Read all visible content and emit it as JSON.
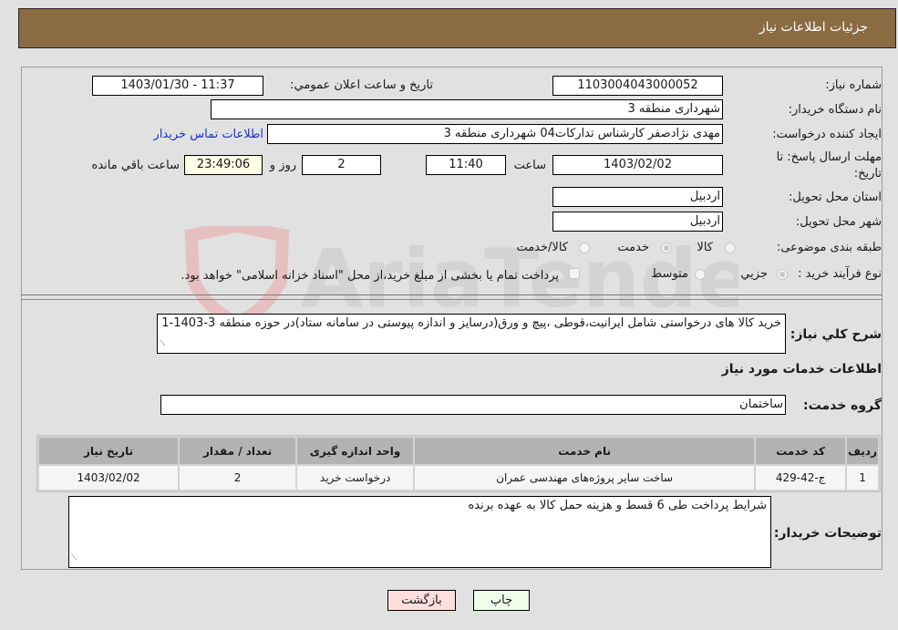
{
  "header": {
    "title": "جزئیات اطلاعات نیاز"
  },
  "form": {
    "need_number": {
      "label": "شماره نیاز:",
      "value": "1103004043000052"
    },
    "announce_datetime": {
      "label": "تاریخ و ساعت اعلان عمومي:",
      "value": "1403/01/30 - 11:37"
    },
    "buyer_org": {
      "label": "نام دستگاه خریدار:",
      "value": "شهرداری منطقه 3"
    },
    "requester": {
      "label": "ایجاد کننده درخواست:",
      "value": "مهدی نژادصفر کارشناس تدارکات04 شهرداری منطقه 3",
      "contact_link": "اطلاعات تماس خریدار"
    },
    "deadline": {
      "label_line1": "مهلت ارسال پاسخ: تا",
      "label_line2": "تاریخ:",
      "date": "1403/02/02",
      "time_label": "ساعت",
      "time": "11:40",
      "days": "2",
      "days_label": "روز و",
      "remaining": "23:49:06",
      "remaining_label": "ساعت باقي مانده"
    },
    "province": {
      "label": "استان محل تحویل:",
      "value": "اردبیل"
    },
    "city": {
      "label": "شهر محل تحویل:",
      "value": "اردبیل"
    },
    "category": {
      "label": "طبقه بندی موضوعی:",
      "options": [
        "کالا",
        "خدمت",
        "کالا/خدمت"
      ],
      "selected": "خدمت"
    },
    "purchase_type": {
      "label": "نوع فرآیند خرید :",
      "options": [
        "جزيي",
        "متوسط"
      ],
      "selected": "جزيي",
      "treasury_text": "پرداخت تمام یا بخشی از مبلغ خرید،از محل \"اسناد خزانه اسلامی\" خواهد بود."
    }
  },
  "description": {
    "label": "شرح کلي نياز:",
    "value": "خرید کالا های درخواستی شامل ایرانیت،قوطی ،پیچ و ورق(درسایز و اندازه پیوستی  در سامانه ستاد)در حوزه منطقه 3-1403-1"
  },
  "services": {
    "section_title": "اطلاعات خدمات مورد نیاز",
    "group_label": "گروه خدمت:",
    "group_value": "ساختمان",
    "table": {
      "headers": [
        "ردیف",
        "کد خدمت",
        "نام خدمت",
        "واحد اندازه گیری",
        "تعداد / مقدار",
        "تاریخ نیاز"
      ],
      "rows": [
        [
          "1",
          "ج-42-429",
          "ساخت سایر پروژه‌های مهندسی عمران",
          "درخواست خرید",
          "2",
          "1403/02/02"
        ]
      ]
    }
  },
  "buyer_notes": {
    "label": "توضیحات خریدار:",
    "value": "شرایط پرداخت طی 6 قسط و هزینه حمل کالا به عهده برنده"
  },
  "buttons": {
    "print": "چاپ",
    "back": "بازگشت"
  },
  "watermark": {
    "text": "AriaTender.neT"
  },
  "colors": {
    "header_bg": "#8b6b42",
    "print_bg": "#efffe9",
    "back_bg": "#ffdede",
    "link": "#1a2fcc"
  }
}
